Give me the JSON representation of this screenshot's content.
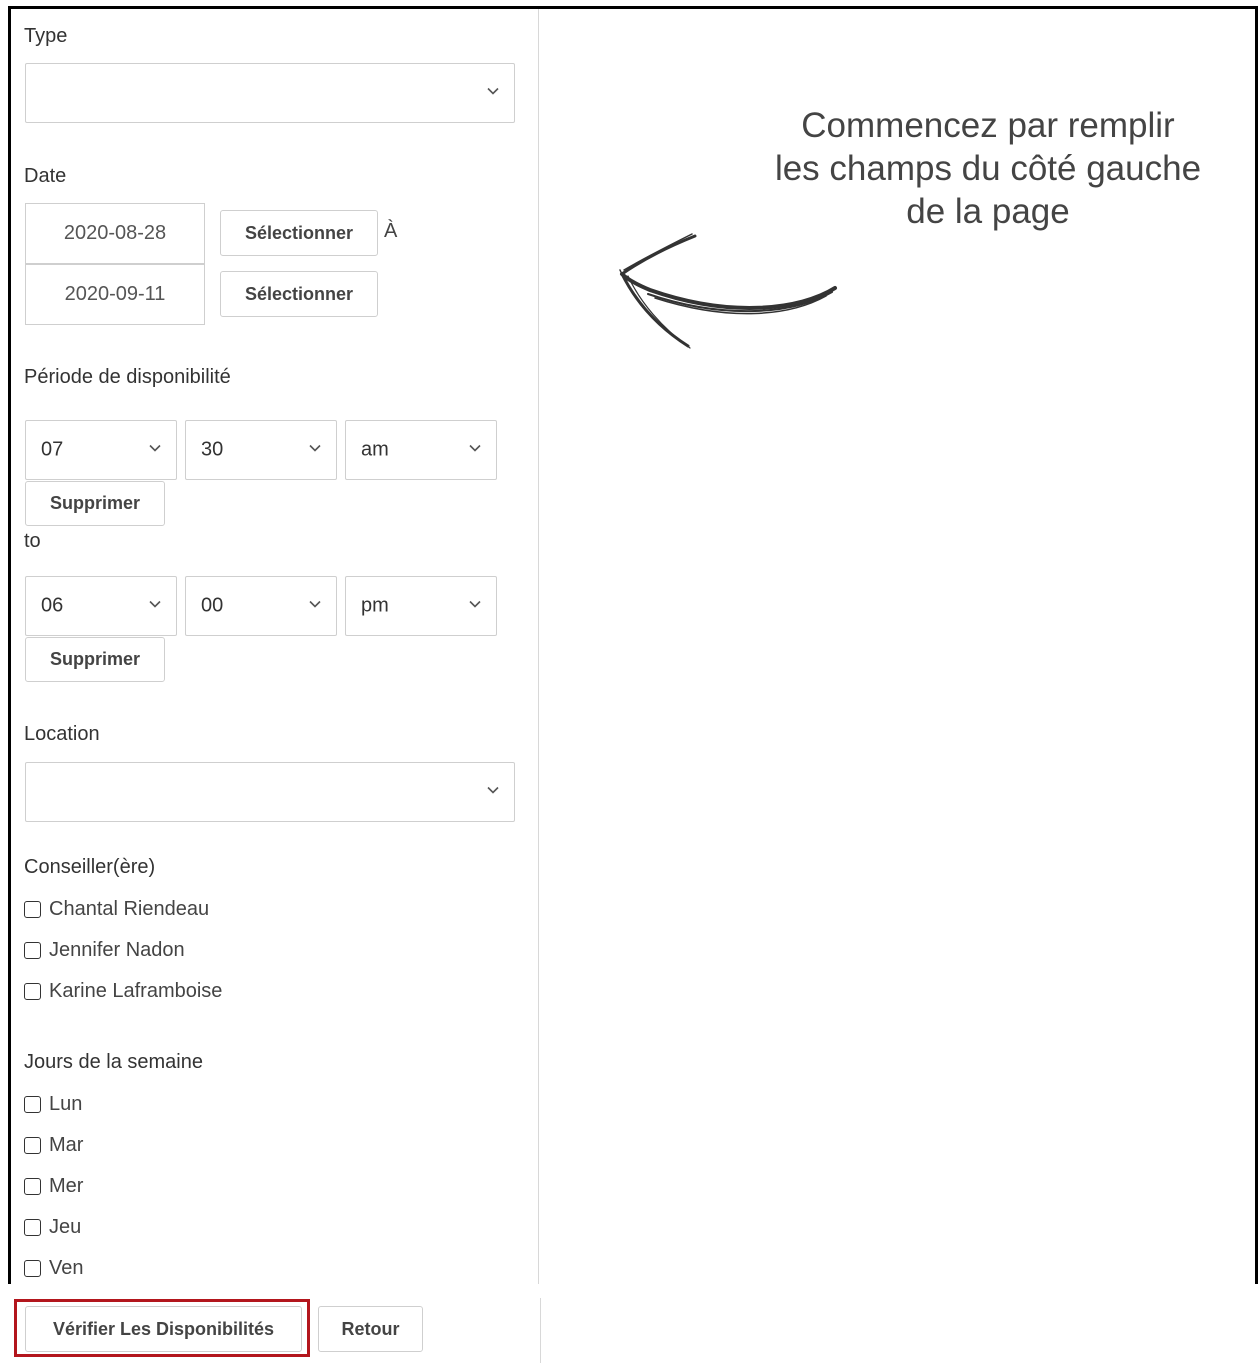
{
  "form": {
    "type_label": "Type",
    "type_value": "",
    "date_label": "Date",
    "date_from": "2020-08-28",
    "date_to": "2020-09-11",
    "select_label": "Sélectionner",
    "date_separator": "À",
    "period_label": "Période de disponibilité",
    "start_time": {
      "hour": "07",
      "minute": "30",
      "ampm": "am"
    },
    "end_time": {
      "hour": "06",
      "minute": "00",
      "ampm": "pm"
    },
    "remove_label": "Supprimer",
    "to_label": "to",
    "location_label": "Location",
    "location_value": "",
    "advisor_label": "Conseiller(ère)",
    "advisors": [
      "Chantal Riendeau",
      "Jennifer Nadon",
      "Karine Laframboise"
    ],
    "weekdays_label": "Jours de la semaine",
    "weekdays": [
      "Lun",
      "Mar",
      "Mer",
      "Jeu",
      "Ven"
    ]
  },
  "actions": {
    "check_label": "Vérifier Les Disponibilités",
    "back_label": "Retour"
  },
  "hint": {
    "line1": "Commencez par remplir",
    "line2": "les champs du côté gauche",
    "line3": "de la page"
  },
  "colors": {
    "highlight": "#b3161d",
    "border": "#cfcfcf"
  },
  "icons": {
    "chevron": "chevron-down-icon",
    "arrow": "hand-drawn-arrow-left-icon"
  }
}
